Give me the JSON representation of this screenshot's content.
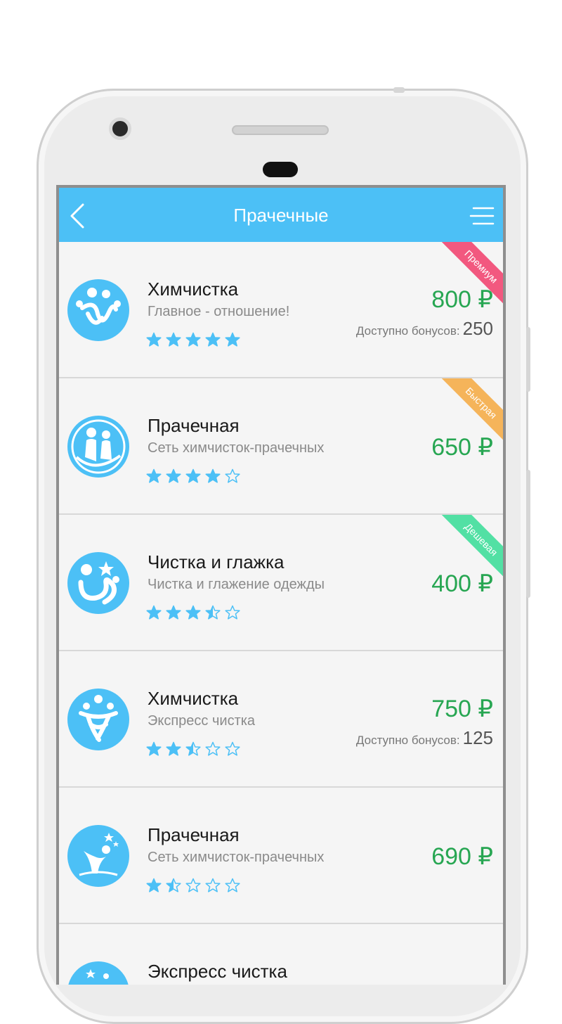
{
  "header": {
    "title": "Прачечные"
  },
  "colors": {
    "accent": "#4cc0f6",
    "price": "#27a652",
    "star": "#4cc0f6",
    "premium": "#f2587f",
    "fast": "#f5b45a",
    "cheap": "#52e0a4"
  },
  "items": [
    {
      "name": "Химчистка",
      "subtitle": "Главное - отношение!",
      "rating": 5,
      "price": "800 ₽",
      "bonus_label": "Доступно бонусов:",
      "bonus_value": "250",
      "ribbon": "Премиум",
      "ribbon_color": "#f2587f"
    },
    {
      "name": "Прачечная",
      "subtitle": "Сеть химчисток-прачечных",
      "rating": 4,
      "price": "650 ₽",
      "bonus_label": "",
      "bonus_value": "",
      "ribbon": "Быстрая",
      "ribbon_color": "#f5b45a"
    },
    {
      "name": "Чистка и глажка",
      "subtitle": "Чистка и глажение одежды",
      "rating": 3.5,
      "price": "400 ₽",
      "bonus_label": "",
      "bonus_value": "",
      "ribbon": "Дешевая",
      "ribbon_color": "#52e0a4"
    },
    {
      "name": "Химчистка",
      "subtitle": "Экспресс чистка",
      "rating": 2.5,
      "price": "750 ₽",
      "bonus_label": "Доступно бонусов:",
      "bonus_value": "125",
      "ribbon": "",
      "ribbon_color": ""
    },
    {
      "name": "Прачечная",
      "subtitle": "Сеть химчисток-прачечных",
      "rating": 1.5,
      "price": "690 ₽",
      "bonus_label": "",
      "bonus_value": "",
      "ribbon": "",
      "ribbon_color": ""
    },
    {
      "name": "Экспресс чистка",
      "subtitle": "",
      "rating": 0,
      "price": "",
      "bonus_label": "",
      "bonus_value": "",
      "ribbon": "",
      "ribbon_color": ""
    }
  ]
}
